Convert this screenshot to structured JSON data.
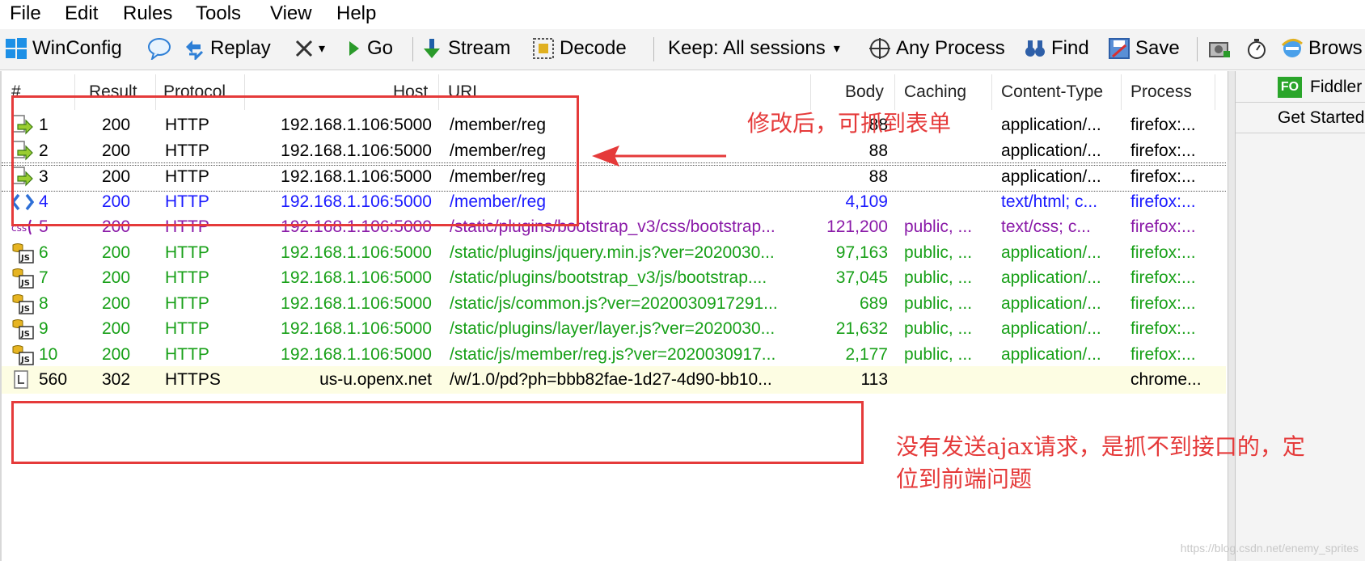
{
  "menu": [
    "File",
    "Edit",
    "Rules",
    "Tools",
    "View",
    "Help"
  ],
  "toolbar": {
    "winconfig": "WinConfig",
    "replay": "Replay",
    "remove_dropdown": "▾",
    "go": "Go",
    "stream": "Stream",
    "decode": "Decode",
    "keep": "Keep: All sessions",
    "keep_dropdown": "▾",
    "any_process": "Any Process",
    "find": "Find",
    "save": "Save",
    "browse": "Brows"
  },
  "columns": {
    "num": "#",
    "result": "Result",
    "protocol": "Protocol",
    "host": "Host",
    "url": "URL",
    "body": "Body",
    "caching": "Caching",
    "content_type": "Content-Type",
    "process": "Process"
  },
  "sessions": [
    {
      "num": "1",
      "result": "200",
      "protocol": "HTTP",
      "host": "192.168.1.106:5000",
      "url": "/member/reg",
      "body": "88",
      "caching": "",
      "content_type": "application/...",
      "process": "firefox:...",
      "color": "#000000",
      "icon": "request-arrow-icon"
    },
    {
      "num": "2",
      "result": "200",
      "protocol": "HTTP",
      "host": "192.168.1.106:5000",
      "url": "/member/reg",
      "body": "88",
      "caching": "",
      "content_type": "application/...",
      "process": "firefox:...",
      "color": "#000000",
      "icon": "request-arrow-icon"
    },
    {
      "num": "3",
      "result": "200",
      "protocol": "HTTP",
      "host": "192.168.1.106:5000",
      "url": "/member/reg",
      "body": "88",
      "caching": "",
      "content_type": "application/...",
      "process": "firefox:...",
      "color": "#000000",
      "icon": "request-arrow-icon"
    },
    {
      "num": "4",
      "result": "200",
      "protocol": "HTTP",
      "host": "192.168.1.106:5000",
      "url": "/member/reg",
      "body": "4,109",
      "caching": "",
      "content_type": "text/html; c...",
      "process": "firefox:...",
      "color": "#1a1aff",
      "icon": "html-icon"
    },
    {
      "num": "5",
      "result": "200",
      "protocol": "HTTP",
      "host": "192.168.1.106:5000",
      "url": "/static/plugins/bootstrap_v3/css/bootstrap...",
      "body": "121,200",
      "caching": "public, ...",
      "content_type": "text/css; c...",
      "process": "firefox:...",
      "color": "#8a1aa8",
      "icon": "css-icon"
    },
    {
      "num": "6",
      "result": "200",
      "protocol": "HTTP",
      "host": "192.168.1.106:5000",
      "url": "/static/plugins/jquery.min.js?ver=2020030...",
      "body": "97,163",
      "caching": "public, ...",
      "content_type": "application/...",
      "process": "firefox:...",
      "color": "#18a018",
      "icon": "js-icon"
    },
    {
      "num": "7",
      "result": "200",
      "protocol": "HTTP",
      "host": "192.168.1.106:5000",
      "url": "/static/plugins/bootstrap_v3/js/bootstrap....",
      "body": "37,045",
      "caching": "public, ...",
      "content_type": "application/...",
      "process": "firefox:...",
      "color": "#18a018",
      "icon": "js-icon"
    },
    {
      "num": "8",
      "result": "200",
      "protocol": "HTTP",
      "host": "192.168.1.106:5000",
      "url": "/static/js/common.js?ver=2020030917291...",
      "body": "689",
      "caching": "public, ...",
      "content_type": "application/...",
      "process": "firefox:...",
      "color": "#18a018",
      "icon": "js-icon"
    },
    {
      "num": "9",
      "result": "200",
      "protocol": "HTTP",
      "host": "192.168.1.106:5000",
      "url": "/static/plugins/layer/layer.js?ver=2020030...",
      "body": "21,632",
      "caching": "public, ...",
      "content_type": "application/...",
      "process": "firefox:...",
      "color": "#18a018",
      "icon": "js-icon"
    },
    {
      "num": "10",
      "result": "200",
      "protocol": "HTTP",
      "host": "192.168.1.106:5000",
      "url": "/static/js/member/reg.js?ver=2020030917...",
      "body": "2,177",
      "caching": "public, ...",
      "content_type": "application/...",
      "process": "firefox:...",
      "color": "#18a018",
      "icon": "js-icon"
    },
    {
      "num": "560",
      "result": "302",
      "protocol": "HTTPS",
      "host": "us-u.openx.net",
      "url": "/w/1.0/pd?ph=bbb82fae-1d27-4d90-bb10...",
      "body": "113",
      "caching": "",
      "content_type": "",
      "process": "chrome...",
      "color": "#000000",
      "icon": "redirect-icon"
    }
  ],
  "right_pane": {
    "fo_badge": "FO",
    "tab1": "Fiddler",
    "tab2": "Get Started"
  },
  "annotations": {
    "top": "修改后，可抓到表单",
    "bottom_line1": "没有发送ajax请求，是抓不到接口的，定",
    "bottom_line2": "位到前端问题",
    "color": "#e53a3a"
  },
  "watermark": "https://blog.csdn.net/enemy_sprites"
}
